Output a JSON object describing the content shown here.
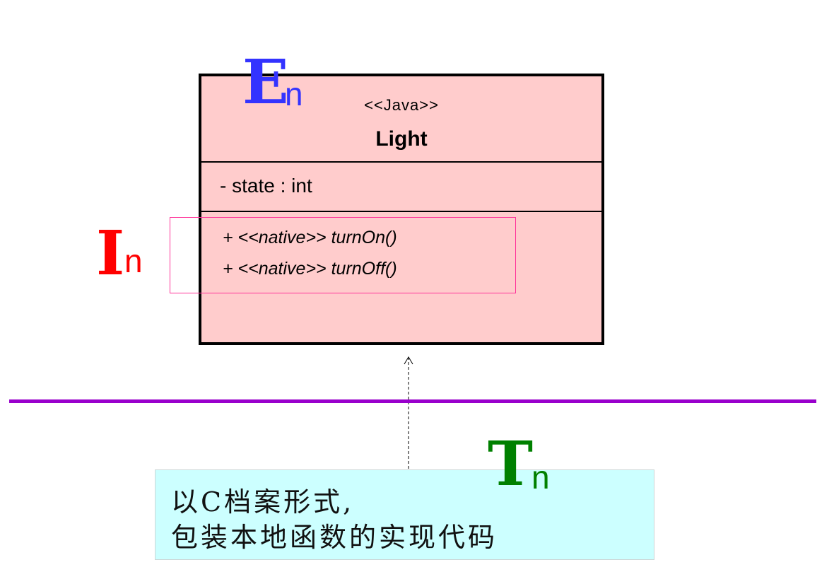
{
  "uml_class": {
    "stereotype": "<<Java>>",
    "name": "Light",
    "attributes": [
      "- state : int"
    ],
    "operations": [
      "+ <<native>> turnOn()",
      "+ <<native>> turnOff()"
    ],
    "fill_color": "#ffcccc",
    "border_color": "#000000"
  },
  "labels": {
    "e": {
      "letter": "E",
      "sub": "n",
      "color": "#3333ff"
    },
    "i": {
      "letter": "I",
      "sub": "n",
      "color": "#ff0000"
    },
    "t": {
      "letter": "T",
      "sub": "n",
      "color": "#008000"
    }
  },
  "note": {
    "lines": [
      "以C档案形式,",
      "包装本地函数的实现代码"
    ],
    "fill_color": "#ccffff"
  },
  "colors": {
    "separator": "#9900cc",
    "highlight": "#ff3399"
  }
}
